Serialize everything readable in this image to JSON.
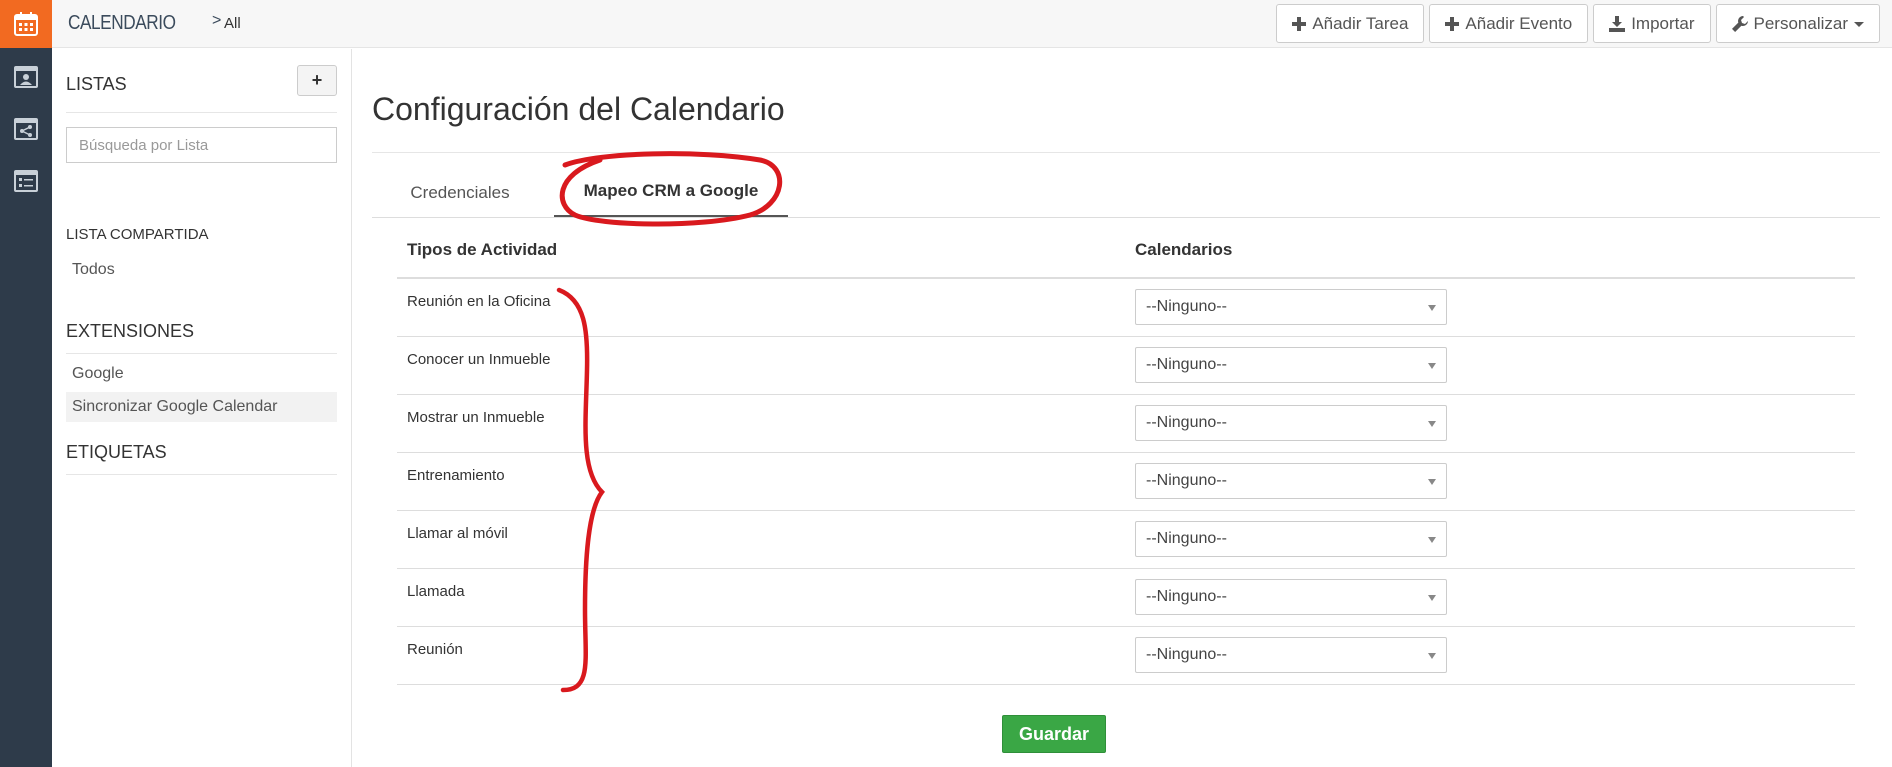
{
  "header": {
    "module_title": "CALENDARIO",
    "breadcrumb_separator": ">",
    "breadcrumb": "All",
    "actions": [
      {
        "label": "Añadir Tarea",
        "icon": "plus-icon"
      },
      {
        "label": "Añadir Evento",
        "icon": "plus-icon"
      },
      {
        "label": "Importar",
        "icon": "download-icon"
      },
      {
        "label": "Personalizar",
        "icon": "wrench-icon",
        "dropdown": true
      }
    ]
  },
  "rail": {
    "icons": [
      "calendar-icon",
      "user-calendar-icon",
      "shared-calendar-icon",
      "list-calendar-icon"
    ],
    "accent": "#f26a21",
    "background": "#2e3b4a"
  },
  "sidebar": {
    "lists_title": "LISTAS",
    "add_button": "+",
    "search_placeholder": "Búsqueda por Lista",
    "shared_title": "LISTA COMPARTIDA",
    "shared_items": [
      "Todos"
    ],
    "extensions_title": "EXTENSIONES",
    "extension_items": [
      "Google",
      "Sincronizar Google Calendar"
    ],
    "tags_title": "ETIQUETAS"
  },
  "main": {
    "title": "Configuración del Calendario",
    "tabs": [
      {
        "label": "Credenciales",
        "active": false
      },
      {
        "label": "Mapeo CRM a Google",
        "active": true
      }
    ],
    "table": {
      "columns": [
        "Tipos de Actividad",
        "Calendarios"
      ],
      "rows": [
        {
          "activity": "Reunión en la Oficina",
          "calendar": "--Ninguno--"
        },
        {
          "activity": "Conocer un Inmueble",
          "calendar": "--Ninguno--"
        },
        {
          "activity": "Mostrar un Inmueble",
          "calendar": "--Ninguno--"
        },
        {
          "activity": "Entrenamiento",
          "calendar": "--Ninguno--"
        },
        {
          "activity": "Llamar al móvil",
          "calendar": "--Ninguno--"
        },
        {
          "activity": "Llamada",
          "calendar": "--Ninguno--"
        },
        {
          "activity": "Reunión",
          "calendar": "--Ninguno--"
        }
      ]
    },
    "save_label": "Guardar",
    "save_color": "#3aa745",
    "annotation_color": "#d9191e"
  }
}
